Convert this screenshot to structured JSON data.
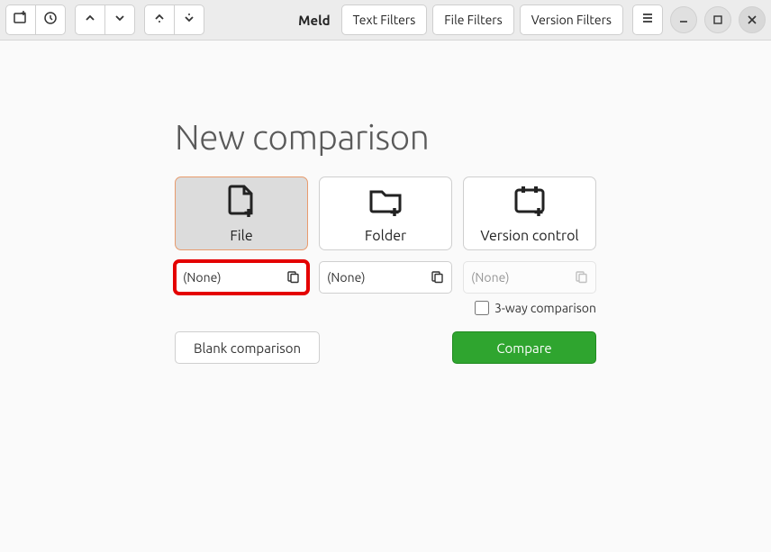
{
  "header": {
    "title": "Meld",
    "text_filters": "Text Filters",
    "file_filters": "File Filters",
    "version_filters": "Version Filters"
  },
  "page": {
    "heading": "New comparison"
  },
  "cards": {
    "file": "File",
    "folder": "Folder",
    "vc": "Version control"
  },
  "choosers": {
    "a": "(None)",
    "b": "(None)",
    "c": "(None)"
  },
  "threeway_label": "3-way comparison",
  "actions": {
    "blank": "Blank comparison",
    "compare": "Compare"
  }
}
